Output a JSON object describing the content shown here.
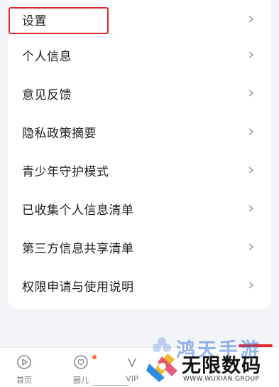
{
  "menu": {
    "items": [
      {
        "label": "设置"
      },
      {
        "label": "个人信息"
      },
      {
        "label": "意见反馈"
      },
      {
        "label": "隐私政策摘要"
      },
      {
        "label": "青少年守护模式"
      },
      {
        "label": "已收集个人信息清单"
      },
      {
        "label": "第三方信息共享清单"
      },
      {
        "label": "权限申请与使用说明"
      }
    ],
    "chevron_icon": "chevron-right-icon"
  },
  "tabbar": {
    "tabs": [
      {
        "label": "首页",
        "icon": "home-play-icon"
      },
      {
        "label": "圈儿",
        "icon": "heart-circle-icon"
      },
      {
        "label": "VIP",
        "icon": "vip-icon"
      }
    ]
  },
  "watermark": {
    "top_text": "鸿天手游",
    "brand": "无限数码",
    "url": "WWW.WUXIAN.GROUP"
  },
  "colors": {
    "highlight_border": "#e0262b",
    "badge_dot": "#ff6a2b",
    "background": "#f3f4f7",
    "card": "#ffffff"
  }
}
